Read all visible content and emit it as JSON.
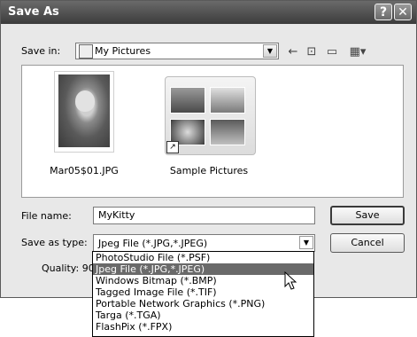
{
  "window": {
    "title": "Save As"
  },
  "title_buttons": {
    "help": "?",
    "close": "✕"
  },
  "save_in": {
    "label": "Save in:",
    "value": "My Pictures"
  },
  "files": [
    {
      "name": "Mar05$01.JPG"
    },
    {
      "name": "Sample Pictures"
    }
  ],
  "file_name": {
    "label": "File name:",
    "value": "MyKitty"
  },
  "save_as_type": {
    "label": "Save as type:",
    "value": "Jpeg File (*.JPG,*.JPEG)"
  },
  "quality": {
    "label": "Quality: 90"
  },
  "buttons": {
    "save": "Save",
    "cancel": "Cancel"
  },
  "type_options": [
    "PhotoStudio File (*.PSF)",
    "Jpeg File (*.JPG,*.JPEG)",
    "Windows Bitmap (*.BMP)",
    "Tagged Image File (*.TIF)",
    "Portable Network Graphics (*.PNG)",
    "Targa (*.TGA)",
    "FlashPix (*.FPX)"
  ],
  "selected_option_index": 1,
  "toolbar_icons": [
    "back-arrow-icon",
    "up-folder-icon",
    "new-folder-icon",
    "views-menu-icon"
  ]
}
